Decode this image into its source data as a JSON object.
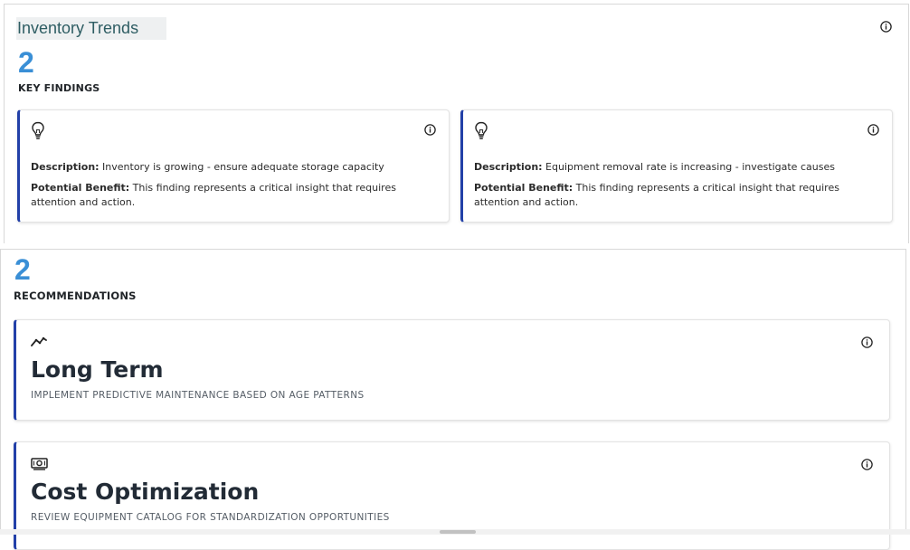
{
  "findings_section": {
    "title": "Inventory Trends",
    "count": "2",
    "count_label": "KEY FINDINGS",
    "cards": [
      {
        "icon": "lightbulb-icon",
        "description_label": "Description:",
        "description": "Inventory is growing - ensure adequate storage capacity",
        "benefit_label": "Potential Benefit:",
        "benefit": "This finding represents a critical insight that requires attention and action."
      },
      {
        "icon": "lightbulb-icon",
        "description_label": "Description:",
        "description": "Equipment removal rate is increasing - investigate causes",
        "benefit_label": "Potential Benefit:",
        "benefit": "This finding represents a critical insight that requires attention and action."
      }
    ]
  },
  "recommendations_section": {
    "count": "2",
    "count_label": "RECOMMENDATIONS",
    "cards": [
      {
        "icon": "trend-line-icon",
        "title": "Long Term",
        "subtitle": "IMPLEMENT PREDICTIVE MAINTENANCE BASED ON AGE PATTERNS"
      },
      {
        "icon": "money-bill-icon",
        "title": "Cost Optimization",
        "subtitle": "REVIEW EQUIPMENT CATALOG FOR STANDARDIZATION OPPORTUNITIES"
      }
    ]
  },
  "colors": {
    "accent_border": "#2240a8",
    "count_blue": "#3a8fd6",
    "title_teal": "#2e5d63"
  }
}
